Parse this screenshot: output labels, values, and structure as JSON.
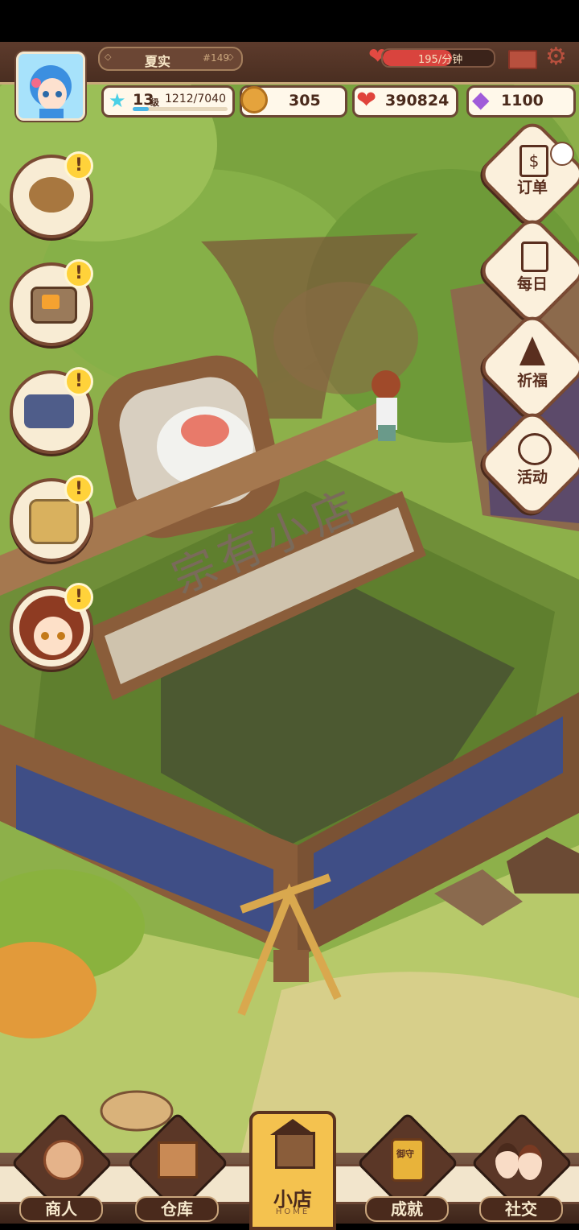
{
  "player": {
    "name": "夏实",
    "id": "#149",
    "level": "13",
    "level_unit": "级",
    "xp": "1212/7040",
    "xp_progress": 0.172
  },
  "rate": {
    "text": "195/分钟",
    "fill": 0.62
  },
  "resources": {
    "coins": "305",
    "hearts": "390824",
    "gems": "1100"
  },
  "shop_sign": "宗有小店",
  "right_menu": [
    {
      "label": "订单",
      "icon": "order-icon"
    },
    {
      "label": "每日",
      "icon": "daily-icon"
    },
    {
      "label": "祈福",
      "icon": "bless-icon"
    },
    {
      "label": "活动",
      "icon": "event-icon"
    }
  ],
  "left_menu": [
    {
      "icon": "potato-icon"
    },
    {
      "icon": "tv-icon"
    },
    {
      "icon": "machine-icon"
    },
    {
      "icon": "armchair-icon"
    },
    {
      "icon": "girl-avatar-icon"
    }
  ],
  "alert_mark": "!",
  "bottom_nav": {
    "merchant": "商人",
    "warehouse": "仓库",
    "home": "小店",
    "home_sub": "HOME",
    "achievement": "成就",
    "social": "社交",
    "charm_text": "御守"
  },
  "colors": {
    "hud_brown": "#5d3b2c",
    "frame_cream": "#fff8ea",
    "accent_red": "#d9443e",
    "alert_yellow": "#ffd23a",
    "home_gold": "#f4c24f"
  }
}
